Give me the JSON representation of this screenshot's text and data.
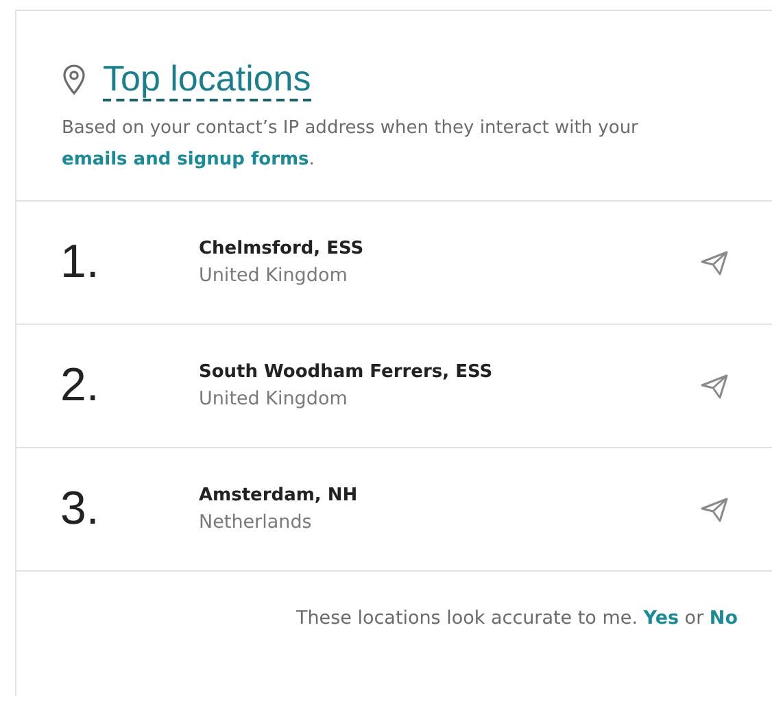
{
  "header": {
    "title": "Top locations",
    "description": "Based on your contact’s IP address when they interact with your",
    "description_link": "emails and signup forms",
    "description_end": "."
  },
  "locations": [
    {
      "rank": "1.",
      "place": "Chelmsford, ESS",
      "country": "United Kingdom"
    },
    {
      "rank": "2.",
      "place": "South Woodham Ferrers, ESS",
      "country": "United Kingdom"
    },
    {
      "rank": "3.",
      "place": "Amsterdam, NH",
      "country": "Netherlands"
    }
  ],
  "footer": {
    "prompt": "These locations look accurate to me.",
    "yes_link": "Yes",
    "conjunction": "or",
    "no_link": "No"
  }
}
